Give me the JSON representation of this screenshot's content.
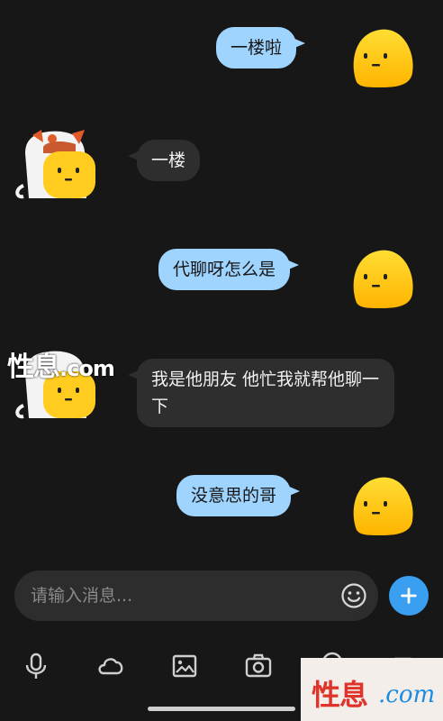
{
  "messages": [
    {
      "side": "out",
      "text": "一楼啦"
    },
    {
      "side": "in",
      "text": "一楼"
    },
    {
      "side": "out",
      "text": "代聊呀怎么是"
    },
    {
      "side": "in",
      "text": "我是他朋友  他忙我就帮他聊一下"
    },
    {
      "side": "out",
      "text": "没意思的哥"
    }
  ],
  "watermark": {
    "main": "性息",
    "suffix": ".com"
  },
  "input": {
    "placeholder": "请输入消息..."
  },
  "toolbar": {
    "icons": [
      "microphone-icon",
      "cloud-icon",
      "image-icon",
      "camera-icon",
      "location-icon",
      "video-icon"
    ]
  },
  "watermark2": {
    "cn": "性息",
    "en": ".com"
  },
  "colors": {
    "background": "#171717",
    "outgoing_bubble": "#9fd4ff",
    "incoming_bubble": "#2e2e2e",
    "accent": "#3a9ff0",
    "avatar_yellow": "#ffcf1a"
  }
}
